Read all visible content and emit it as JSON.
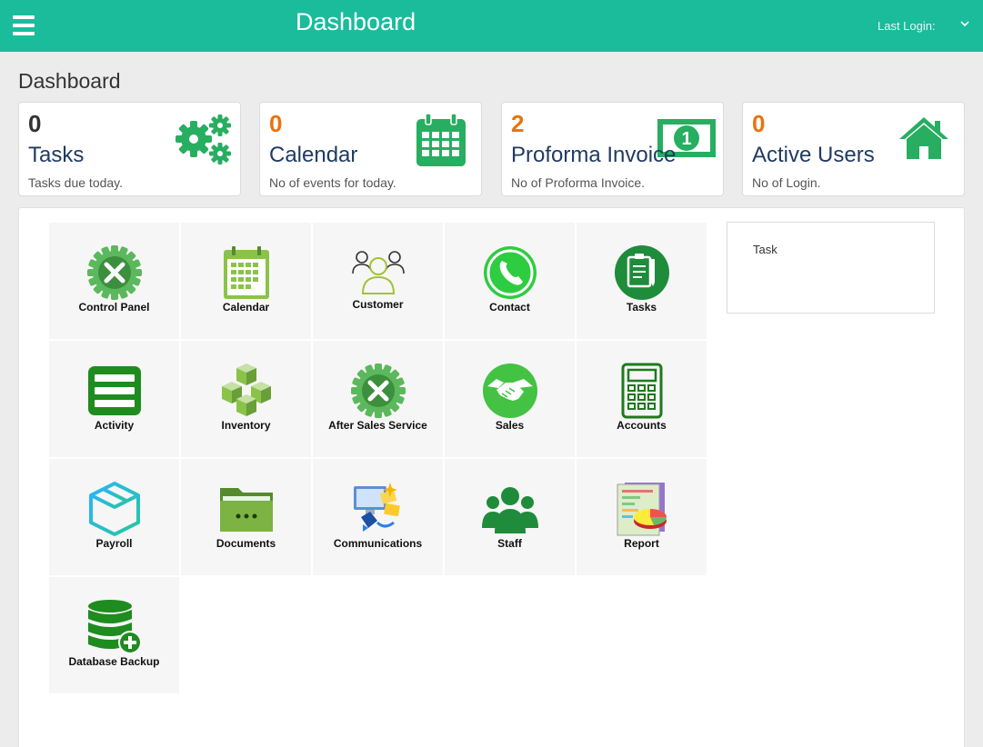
{
  "header": {
    "title": "Dashboard",
    "last_login_label": "Last Login:",
    "brand_color": "#1abc9c"
  },
  "page": {
    "heading": "Dashboard"
  },
  "stats": [
    {
      "count": "0",
      "title": "Tasks",
      "description": "Tasks due today.",
      "count_color": "#333333",
      "icon": "gears-icon"
    },
    {
      "count": "0",
      "title": "Calendar",
      "description": "No of events for today.",
      "count_color": "#e8730c",
      "icon": "calendar-icon"
    },
    {
      "count": "2",
      "title": "Proforma Invoice",
      "description": "No of Proforma Invoice.",
      "count_color": "#e8730c",
      "icon": "banknote-icon"
    },
    {
      "count": "0",
      "title": "Active Users",
      "description": "No of Login.",
      "count_color": "#e8730c",
      "icon": "home-icon"
    }
  ],
  "modules": [
    {
      "label": "Control Panel",
      "icon": "control-panel-icon"
    },
    {
      "label": "Calendar",
      "icon": "calendar-icon"
    },
    {
      "label": "Customer",
      "icon": "customer-icon"
    },
    {
      "label": "Contact",
      "icon": "phone-icon"
    },
    {
      "label": "Tasks",
      "icon": "clipboard-icon"
    },
    {
      "label": "Activity",
      "icon": "activity-icon"
    },
    {
      "label": "Inventory",
      "icon": "boxes-icon"
    },
    {
      "label": "After Sales Service",
      "icon": "service-gear-icon"
    },
    {
      "label": "Sales",
      "icon": "handshake-icon"
    },
    {
      "label": "Accounts",
      "icon": "calculator-icon"
    },
    {
      "label": "Payroll",
      "icon": "package-icon"
    },
    {
      "label": "Documents",
      "icon": "folder-icon"
    },
    {
      "label": "Communications",
      "icon": "communications-icon"
    },
    {
      "label": "Staff",
      "icon": "staff-icon"
    },
    {
      "label": "Report",
      "icon": "report-icon"
    },
    {
      "label": "Database Backup",
      "icon": "database-backup-icon"
    }
  ],
  "task_panel": {
    "title": "Task"
  }
}
